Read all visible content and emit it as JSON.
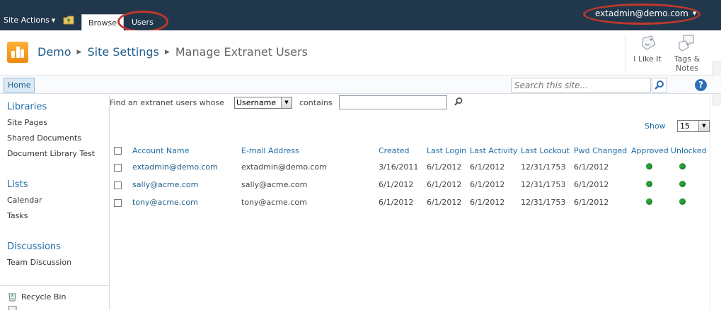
{
  "ribbon": {
    "site_actions_label": "Site Actions",
    "tabs": [
      {
        "label": "Browse"
      },
      {
        "label": "Users"
      }
    ],
    "user_menu_label": "extadmin@demo.com"
  },
  "title": {
    "breadcrumb": [
      "Demo",
      "Site Settings",
      "Manage Extranet Users"
    ],
    "like_label": "I Like It",
    "tags_label": "Tags &",
    "notes_label": "Notes"
  },
  "topnav": {
    "home_label": "Home",
    "search_placeholder": "Search this site...",
    "help_glyph": "?"
  },
  "quicklaunch": {
    "sections": [
      {
        "heading": "Libraries",
        "items": [
          "Site Pages",
          "Shared Documents",
          "Document Library Test"
        ]
      },
      {
        "heading": "Lists",
        "items": [
          "Calendar",
          "Tasks"
        ]
      },
      {
        "heading": "Discussions",
        "items": [
          "Team Discussion"
        ]
      }
    ],
    "recycle_bin_label": "Recycle Bin"
  },
  "filter": {
    "find_label": "Find an extranet users whose",
    "field_value": "Username",
    "operator_label": "contains",
    "value": ""
  },
  "paging": {
    "show_label": "Show",
    "page_size": "15"
  },
  "table": {
    "headers": [
      "Account Name",
      "E-mail Address",
      "Created",
      "Last Login",
      "Last Activity",
      "Last Lockout",
      "Pwd Changed",
      "Approved",
      "Unlocked"
    ],
    "rows": [
      {
        "account": "extadmin@demo.com",
        "email": "extadmin@demo.com",
        "created": "3/16/2011",
        "last_login": "6/1/2012",
        "last_activity": "6/1/2012",
        "last_lockout": "12/31/1753",
        "pwd_changed": "6/1/2012",
        "approved": true,
        "unlocked": true
      },
      {
        "account": "sally@acme.com",
        "email": "sally@acme.com",
        "created": "6/1/2012",
        "last_login": "6/1/2012",
        "last_activity": "6/1/2012",
        "last_lockout": "12/31/1753",
        "pwd_changed": "6/1/2012",
        "approved": true,
        "unlocked": true
      },
      {
        "account": "tony@acme.com",
        "email": "tony@acme.com",
        "created": "6/1/2012",
        "last_login": "6/1/2012",
        "last_activity": "6/1/2012",
        "last_lockout": "12/31/1753",
        "pwd_changed": "6/1/2012",
        "approved": true,
        "unlocked": true
      }
    ],
    "status_color": "#27a335"
  },
  "colors": {
    "ribbon_bg": "#21374c",
    "link": "#1f6fa8",
    "highlight_oval": "#c0392b"
  }
}
